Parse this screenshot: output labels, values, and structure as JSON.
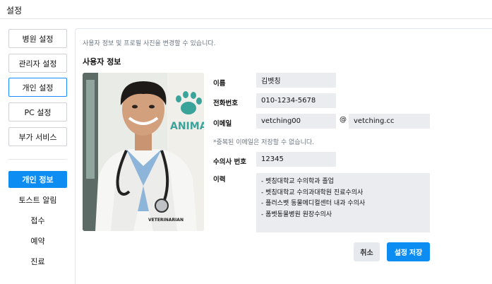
{
  "window": {
    "title": "설정"
  },
  "sidebar": {
    "buttons": [
      {
        "label": "병원 설정"
      },
      {
        "label": "관리자 설정"
      },
      {
        "label": "개인 설정"
      },
      {
        "label": "PC 설정"
      },
      {
        "label": "부가 서비스"
      }
    ],
    "sub_items": [
      {
        "label": "개인 정보"
      },
      {
        "label": "토스트 알림"
      },
      {
        "label": "접수"
      },
      {
        "label": "예약"
      },
      {
        "label": "진료"
      }
    ]
  },
  "main": {
    "description": "사용자 정보 및 프로필 사진을 변경할 수 있습니다.",
    "section_title": "사용자 정보",
    "photo_badge": "VETERINARIAN",
    "photo_sign": "ANIMAL",
    "fields": {
      "name_label": "이름",
      "name_value": "김벳칭",
      "phone_label": "전화번호",
      "phone_value": "010-1234-5678",
      "email_label": "이메일",
      "email_id": "vetching00",
      "email_at": "@",
      "email_domain": "vetching.cc",
      "email_hint": "*중복된 이메일은 저장할 수 없습니다.",
      "license_label": "수의사 번호",
      "license_value": "12345",
      "career_label": "이력",
      "career_lines": [
        "- 벳칭대학교 수의학과 졸업",
        "- 벳칭대학교 수의과대학원 진료수의사",
        "- 플러스벳 동물메디컬센터 내과 수의사",
        "- 폼벳동물병원 원장수의사"
      ]
    },
    "actions": {
      "cancel": "취소",
      "save": "설정 저장"
    }
  },
  "colors": {
    "accent": "#0d8cf2",
    "field_bg": "#eaecf0",
    "hint_text": "#6b7683"
  }
}
